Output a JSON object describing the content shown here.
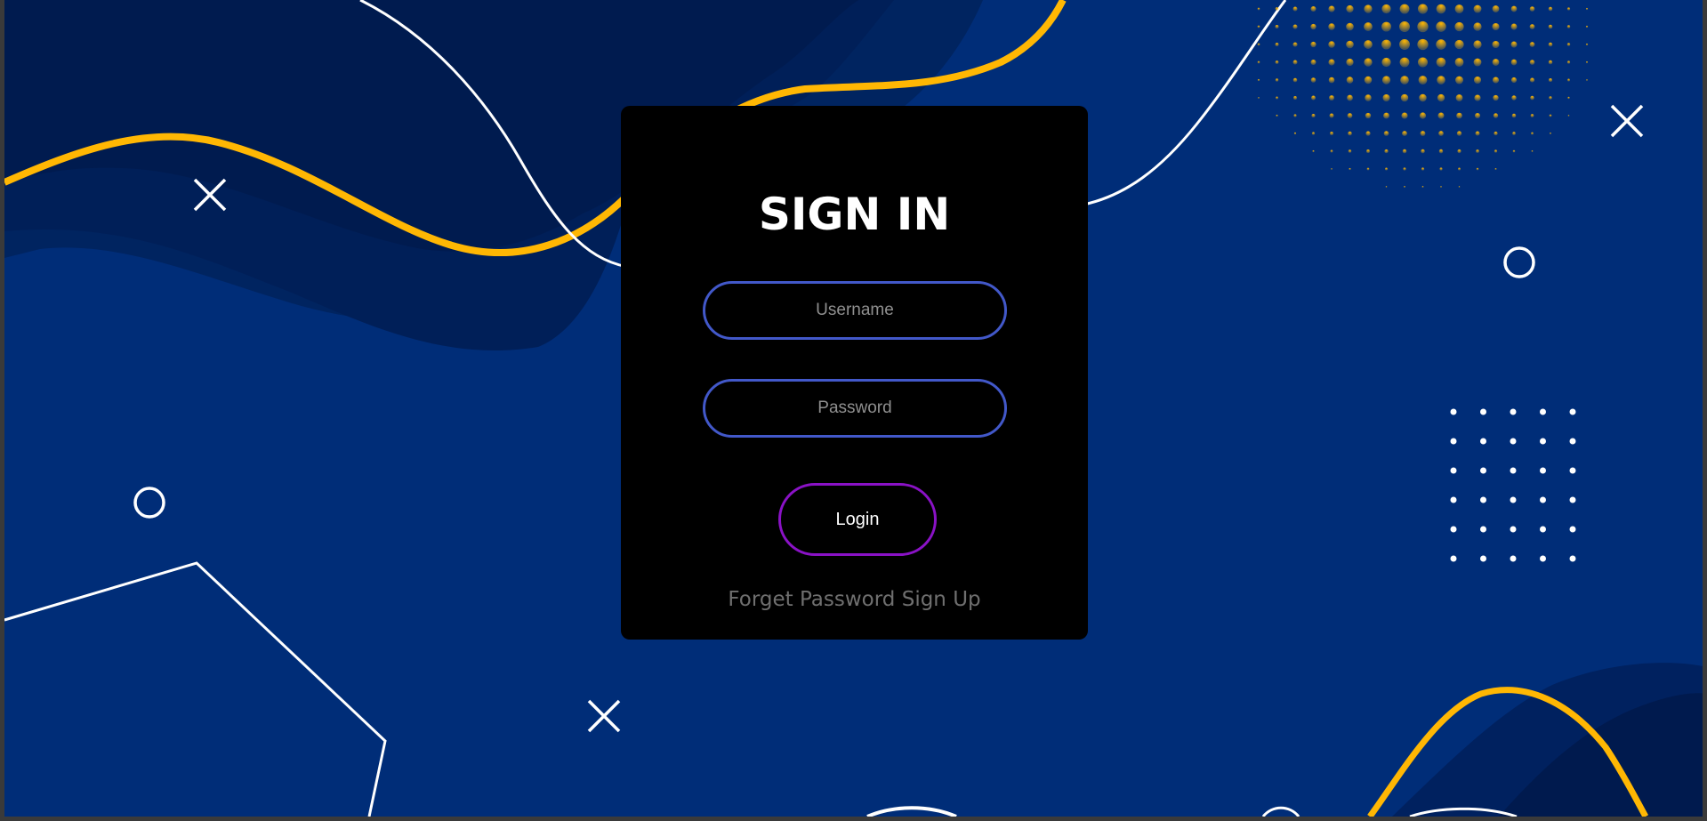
{
  "login_card": {
    "title": "SIGN IN",
    "username_placeholder": "Username",
    "password_placeholder": "Password",
    "login_label": "Login",
    "forget_password_label": "Forget Password",
    "sign_up_label": "Sign Up"
  },
  "colors": {
    "background_blue": "#002d78",
    "accent_yellow": "#ffb703",
    "card_black": "#000000",
    "input_border_blue": "#4258c9",
    "button_border_purple": "#8a12c6",
    "link_gray": "#6f6f6f"
  },
  "decorations": {
    "cross_icons": 4,
    "circle_icons": 3
  }
}
